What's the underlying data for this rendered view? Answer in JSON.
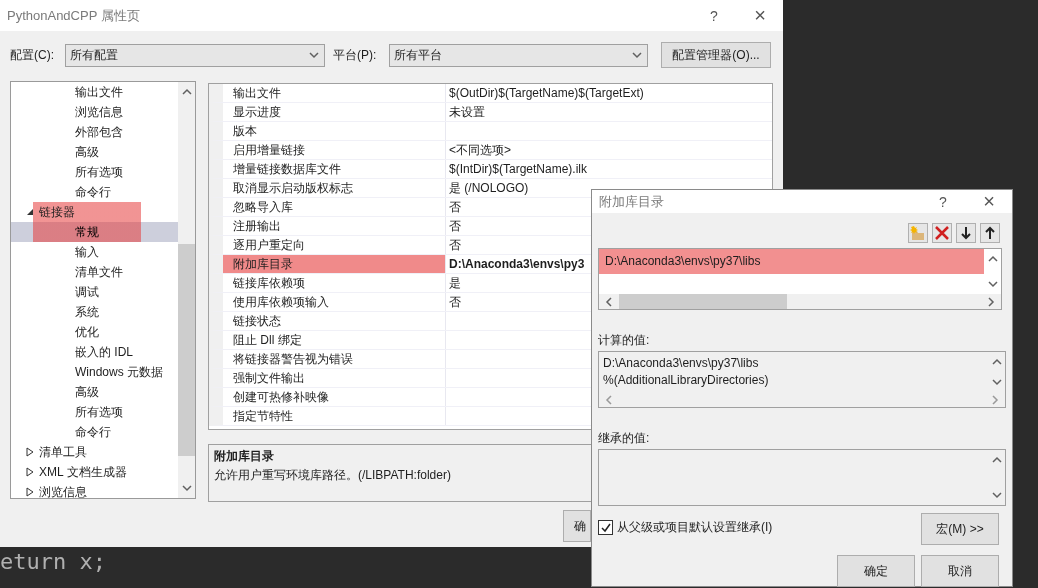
{
  "window": {
    "title": "PythonAndCPP 属性页",
    "help": "?",
    "close": "×"
  },
  "config": {
    "label": "配置(C):",
    "value": "所有配置",
    "platform_label": "平台(P):",
    "platform_value": "所有平台",
    "manager_button": "配置管理器(O)..."
  },
  "tree": {
    "continued_children": [
      {
        "label": "输出文件",
        "selected": false,
        "highlighted": false
      },
      {
        "label": "浏览信息",
        "selected": false,
        "highlighted": false
      },
      {
        "label": "外部包含",
        "selected": false,
        "highlighted": false
      },
      {
        "label": "高级",
        "selected": false,
        "highlighted": false
      },
      {
        "label": "所有选项",
        "selected": false,
        "highlighted": false
      },
      {
        "label": "命令行",
        "selected": false,
        "highlighted": false
      }
    ],
    "items": [
      {
        "label": "链接器",
        "expanded": true,
        "selected": false,
        "highlighted": true,
        "children": [
          {
            "label": "常规",
            "selected": true,
            "highlighted": true
          },
          {
            "label": "输入",
            "selected": false,
            "highlighted": false
          },
          {
            "label": "清单文件",
            "selected": false,
            "highlighted": false
          },
          {
            "label": "调试",
            "selected": false,
            "highlighted": false
          },
          {
            "label": "系统",
            "selected": false,
            "highlighted": false
          },
          {
            "label": "优化",
            "selected": false,
            "highlighted": false
          },
          {
            "label": "嵌入的 IDL",
            "selected": false,
            "highlighted": false
          },
          {
            "label": "Windows 元数据",
            "selected": false,
            "highlighted": false
          },
          {
            "label": "高级",
            "selected": false,
            "highlighted": false
          },
          {
            "label": "所有选项",
            "selected": false,
            "highlighted": false
          },
          {
            "label": "命令行",
            "selected": false,
            "highlighted": false
          }
        ]
      },
      {
        "label": "清单工具",
        "expanded": false,
        "selected": false,
        "highlighted": false
      },
      {
        "label": "XML 文档生成器",
        "expanded": false,
        "selected": false,
        "highlighted": false
      },
      {
        "label": "浏览信息",
        "expanded": false,
        "selected": false,
        "highlighted": false
      }
    ]
  },
  "properties": [
    {
      "name": "输出文件",
      "value": "$(OutDir)$(TargetName)$(TargetExt)",
      "modified": false,
      "highlighted": false
    },
    {
      "name": "显示进度",
      "value": "未设置",
      "modified": false,
      "highlighted": false
    },
    {
      "name": "版本",
      "highlighted": false
    },
    {
      "name": "启用增量链接",
      "value": "<不同选项>",
      "modified": false,
      "highlighted": false
    },
    {
      "name": "增量链接数据库文件",
      "value": "$(IntDir)$(TargetName).ilk",
      "modified": false,
      "highlighted": false
    },
    {
      "name": "取消显示启动版权标志",
      "value": "是 (/NOLOGO)",
      "modified": false,
      "highlighted": false
    },
    {
      "name": "忽略导入库",
      "value": "否",
      "modified": false,
      "highlighted": false
    },
    {
      "name": "注册输出",
      "value": "否",
      "modified": false,
      "highlighted": false
    },
    {
      "name": "逐用户重定向",
      "value": "否",
      "modified": false,
      "highlighted": false
    },
    {
      "name": "附加库目录",
      "value": "D:\\Anaconda3\\envs\\py3",
      "modified": true,
      "highlighted": true
    },
    {
      "name": "链接库依赖项",
      "value": "是",
      "modified": false,
      "highlighted": false
    },
    {
      "name": "使用库依赖项输入",
      "value": "否",
      "modified": false,
      "highlighted": false
    },
    {
      "name": "链接状态",
      "highlighted": false
    },
    {
      "name": "阻止 Dll 绑定",
      "highlighted": false
    },
    {
      "name": "将链接器警告视为错误",
      "highlighted": false
    },
    {
      "name": "强制文件输出",
      "highlighted": false
    },
    {
      "name": "创建可热修补映像",
      "highlighted": false
    },
    {
      "name": "指定节特性",
      "highlighted": false
    }
  ],
  "description": {
    "title": "附加库目录",
    "text": "允许用户重写环境库路径。(/LIBPATH:folder)"
  },
  "buttons": [
    "确"
  ],
  "code_text": "eturn x;",
  "dialog": {
    "title": "附加库目录",
    "help": "?",
    "close": "×",
    "entries": [
      {
        "text": "D:\\Anaconda3\\envs\\py37\\libs",
        "highlighted": true
      }
    ],
    "computed_label": "计算的值:",
    "computed_lines": [
      "D:\\Anaconda3\\envs\\py37\\libs",
      "%(AdditionalLibraryDirectories)"
    ],
    "inherited_label": "继承的值:",
    "inherit": {
      "label": "从父级或项目默认设置继承(I)",
      "checked": true
    },
    "macro_button": "宏(M) >>",
    "ok_button": "确定",
    "cancel_button": "取消"
  }
}
